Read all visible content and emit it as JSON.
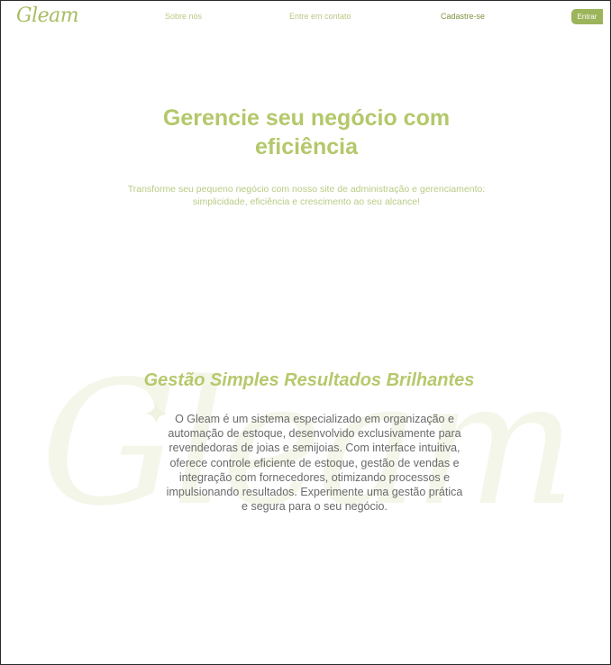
{
  "header": {
    "logo": "Gleam",
    "nav": {
      "about": "Sobre nós",
      "contact": "Entre em contato",
      "signup": "Cadastre-se"
    },
    "login_button": "Entrar"
  },
  "hero": {
    "title_line1": "Gerencie seu negócio com",
    "title_line2": "eficiência",
    "subtitle_line1": "Transforme seu pequeno negócio com nosso site de administração e gerenciamento:",
    "subtitle_line2": "simplicidade, eficiência e crescimento ao seu alcance!"
  },
  "about": {
    "watermark": "Gleam",
    "title": "Gestão Simples Resultados Brilhantes",
    "body": "O Gleam é um sistema especializado em organização e automação de estoque, desenvolvido exclusivamente para revendedoras de joias e semijoias. Com interface intuitiva, oferece controle eficiente de estoque, gestão de vendas e integração com fornecedores, otimizando processos e impulsionando resultados. Experimente uma gestão prática e segura para o seu negócio."
  },
  "colors": {
    "brand": "#a7bd62",
    "button": "#9cb45a",
    "body_text": "#6a6a6a",
    "watermark": "#f4f6ea"
  }
}
